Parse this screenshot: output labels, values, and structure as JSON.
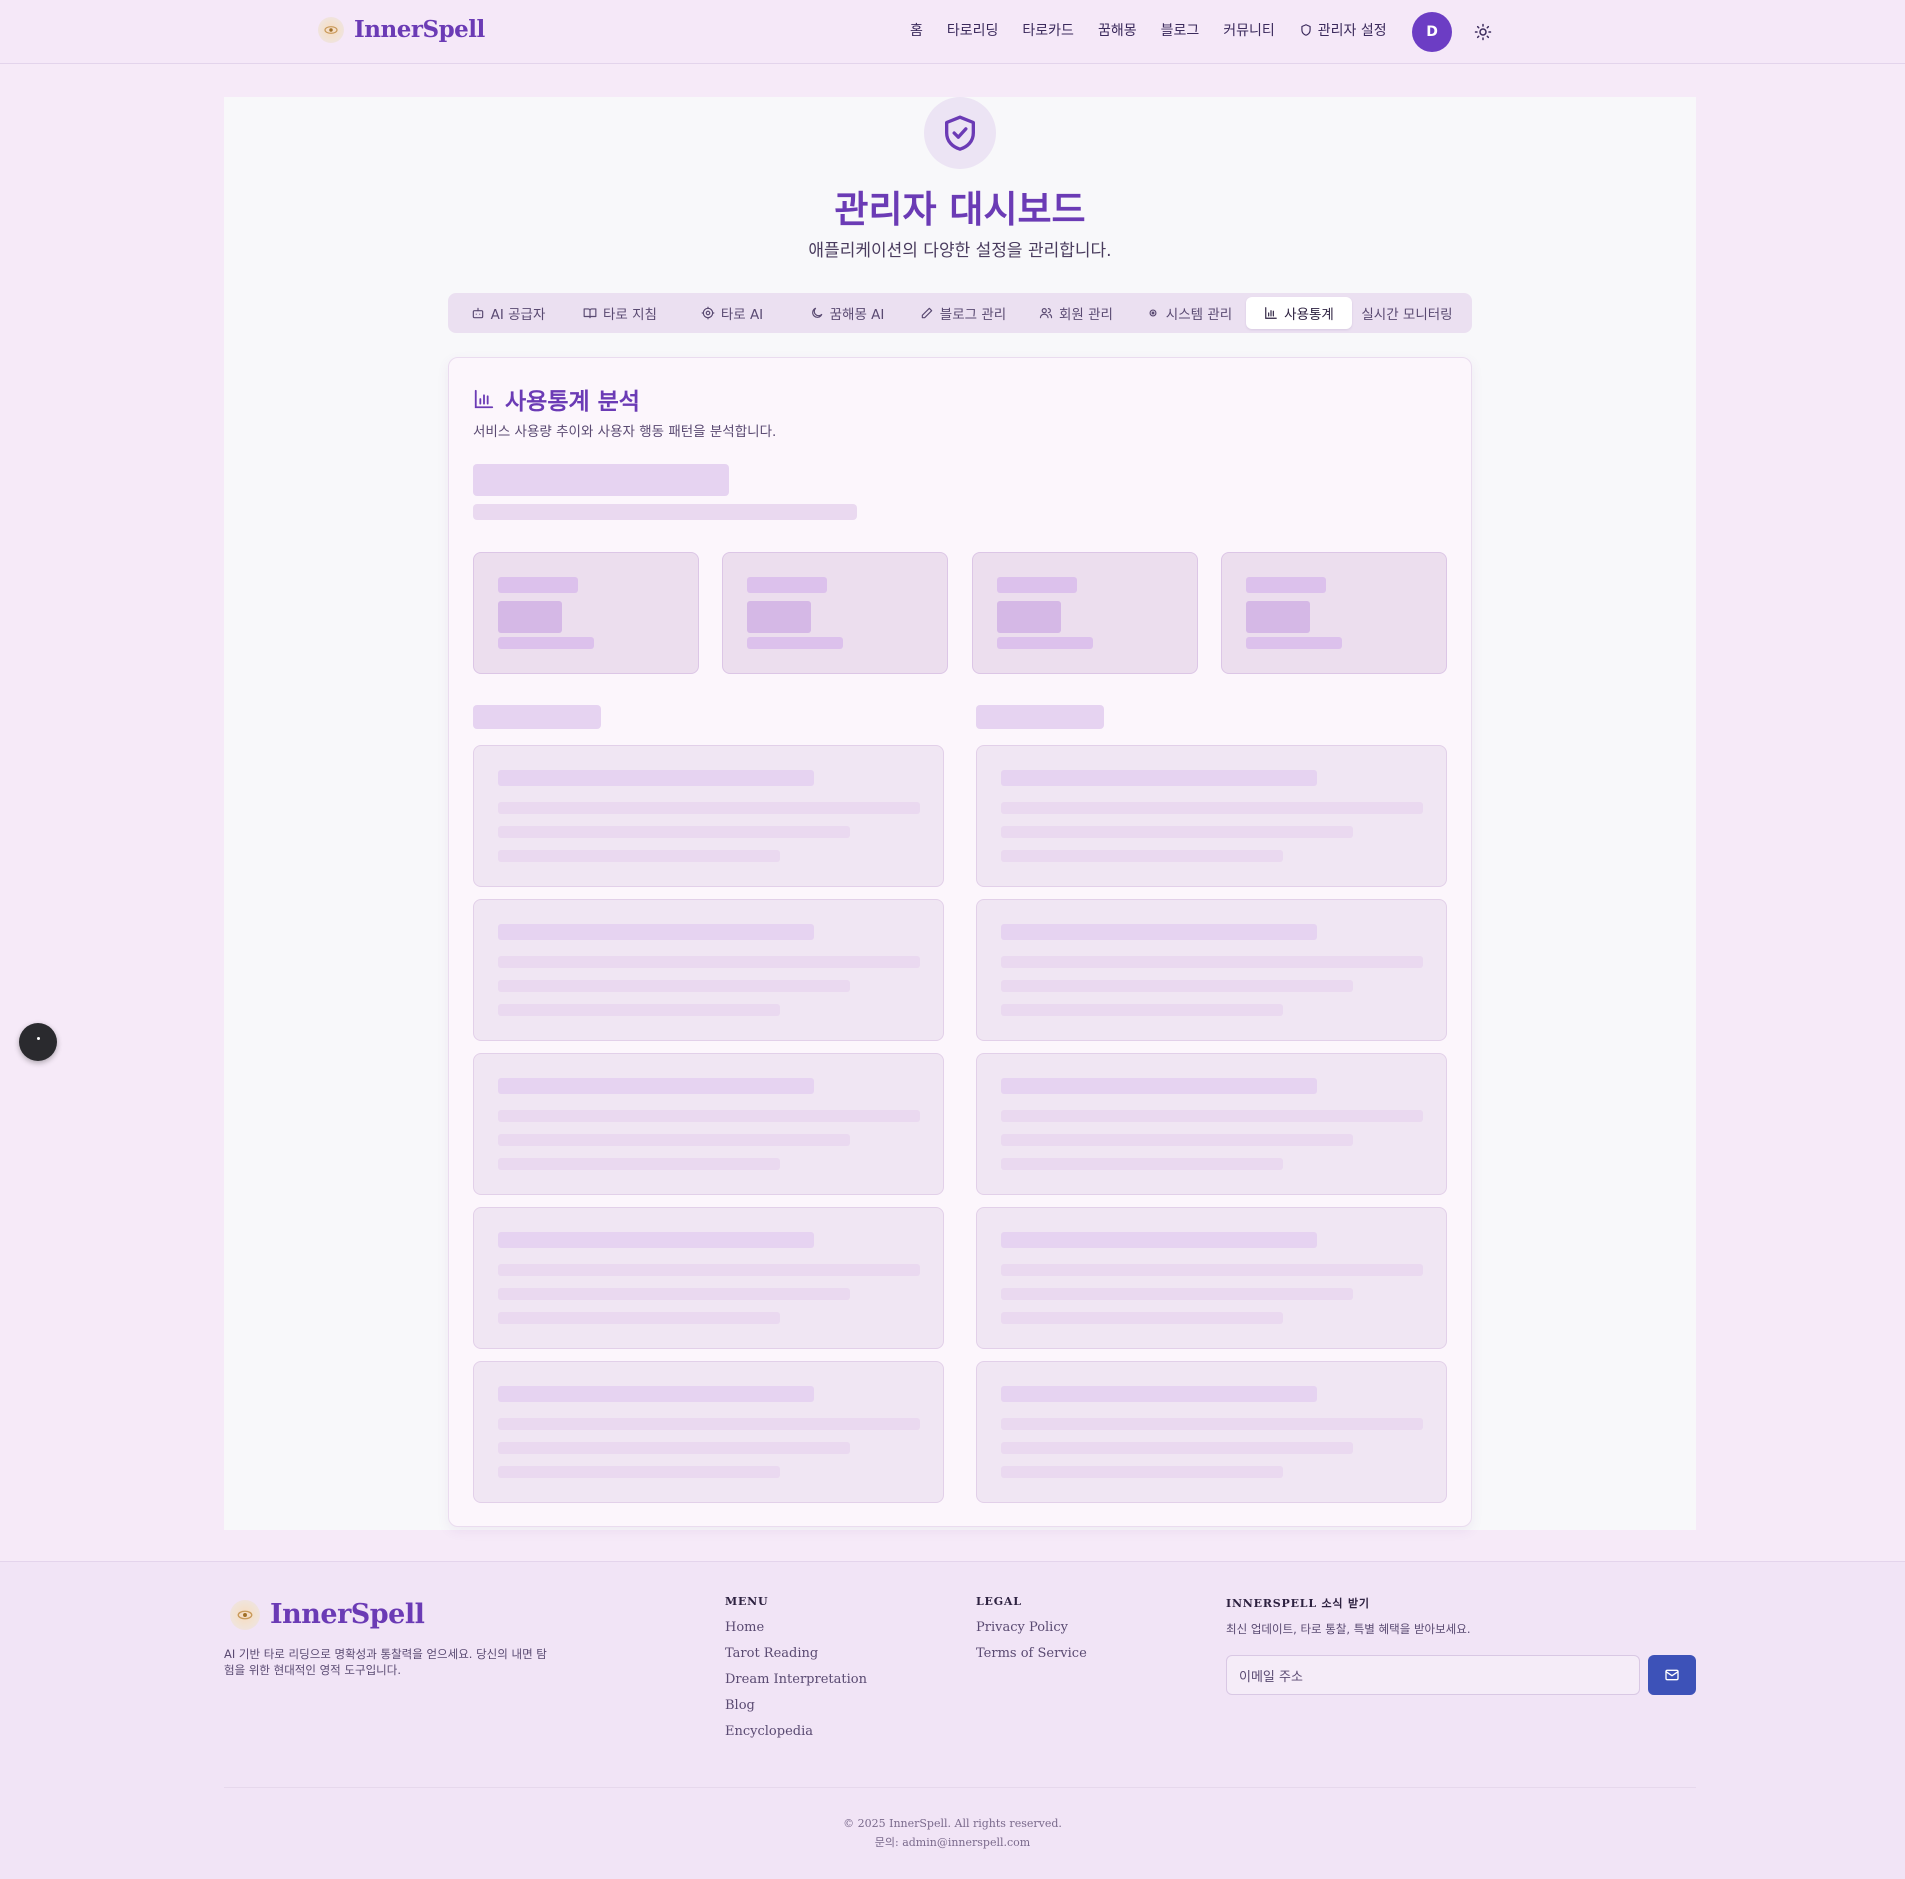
{
  "header": {
    "brand": "InnerSpell",
    "nav": [
      {
        "label": "홈",
        "icon": ""
      },
      {
        "label": "타로리딩",
        "icon": ""
      },
      {
        "label": "타로카드",
        "icon": ""
      },
      {
        "label": "꿈해몽",
        "icon": ""
      },
      {
        "label": "블로그",
        "icon": ""
      },
      {
        "label": "커뮤니티",
        "icon": ""
      },
      {
        "label": "관리자 설정",
        "icon": "shield-icon"
      }
    ],
    "avatar_initial": "D",
    "theme_icon": "sun-icon"
  },
  "page": {
    "icon": "shield-check-icon",
    "title": "관리자 대시보드",
    "subtitle": "애플리케이션의 다양한 설정을 관리합니다."
  },
  "tabs": [
    {
      "label": "AI 공급자",
      "icon": "bot-icon",
      "active": false
    },
    {
      "label": "타로 지침",
      "icon": "book-icon",
      "active": false
    },
    {
      "label": "타로 AI",
      "icon": "cog-icon",
      "active": false
    },
    {
      "label": "꿈해몽 AI",
      "icon": "moon-icon",
      "active": false
    },
    {
      "label": "블로그 관리",
      "icon": "pencil-icon",
      "active": false
    },
    {
      "label": "회원 관리",
      "icon": "users-icon",
      "active": false
    },
    {
      "label": "시스템 관리",
      "icon": "circle-icon",
      "active": false
    },
    {
      "label": "사용통계",
      "icon": "bar-chart-icon",
      "active": true
    },
    {
      "label": "실시간 모니터링",
      "icon": "",
      "active": false
    }
  ],
  "stats_card": {
    "icon": "bar-chart-icon",
    "title": "사용통계 분석",
    "description": "서비스 사용량 추이와 사용자 행동 패턴을 분석합니다."
  },
  "footer": {
    "brand": "InnerSpell",
    "description": "AI 기반 타로 리딩으로 명확성과 통찰력을 얻으세요. 당신의 내면 탐험을 위한 현대적인 영적 도구입니다.",
    "menu_heading": "MENU",
    "menu_links": [
      "Home",
      "Tarot Reading",
      "Dream Interpretation",
      "Blog",
      "Encyclopedia"
    ],
    "legal_heading": "LEGAL",
    "legal_links": [
      "Privacy Policy",
      "Terms of Service"
    ],
    "newsletter_heading": "INNERSPELL 소식 받기",
    "newsletter_desc": "최신 업데이트, 타로 통찰, 특별 혜택을 받아보세요.",
    "email_placeholder": "이메일 주소",
    "submit_icon": "mail-icon",
    "copyright": "© 2025 InnerSpell. All rights reserved.",
    "contact": "문의: admin@innerspell.com"
  },
  "colors": {
    "accent": "#6b3bb5",
    "avatar_bg": "#6c3dc4",
    "submit_bg": "#3d52b8",
    "page_bg": "#f6eaf8"
  }
}
